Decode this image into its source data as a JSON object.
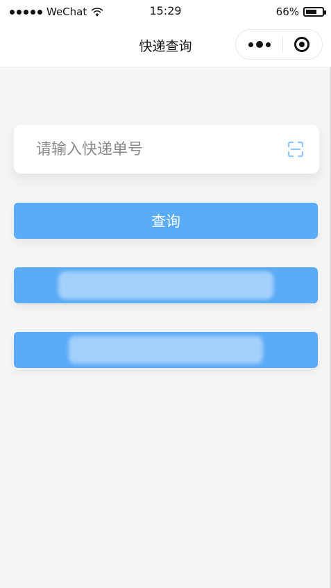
{
  "status_bar": {
    "carrier": "WeChat",
    "time": "15:29",
    "battery_percent": "66%",
    "battery_level": 0.66
  },
  "nav": {
    "title": "快递查询"
  },
  "search": {
    "placeholder": "请输入快递单号",
    "value": ""
  },
  "buttons": {
    "query_label": "查询"
  },
  "colors": {
    "primary_button": "#5aabf8",
    "background": "#f5f5f5"
  },
  "icons": {
    "wifi": "wifi-icon",
    "battery": "battery-icon",
    "more": "more-icon",
    "target": "target-icon",
    "scan": "scan-icon"
  }
}
